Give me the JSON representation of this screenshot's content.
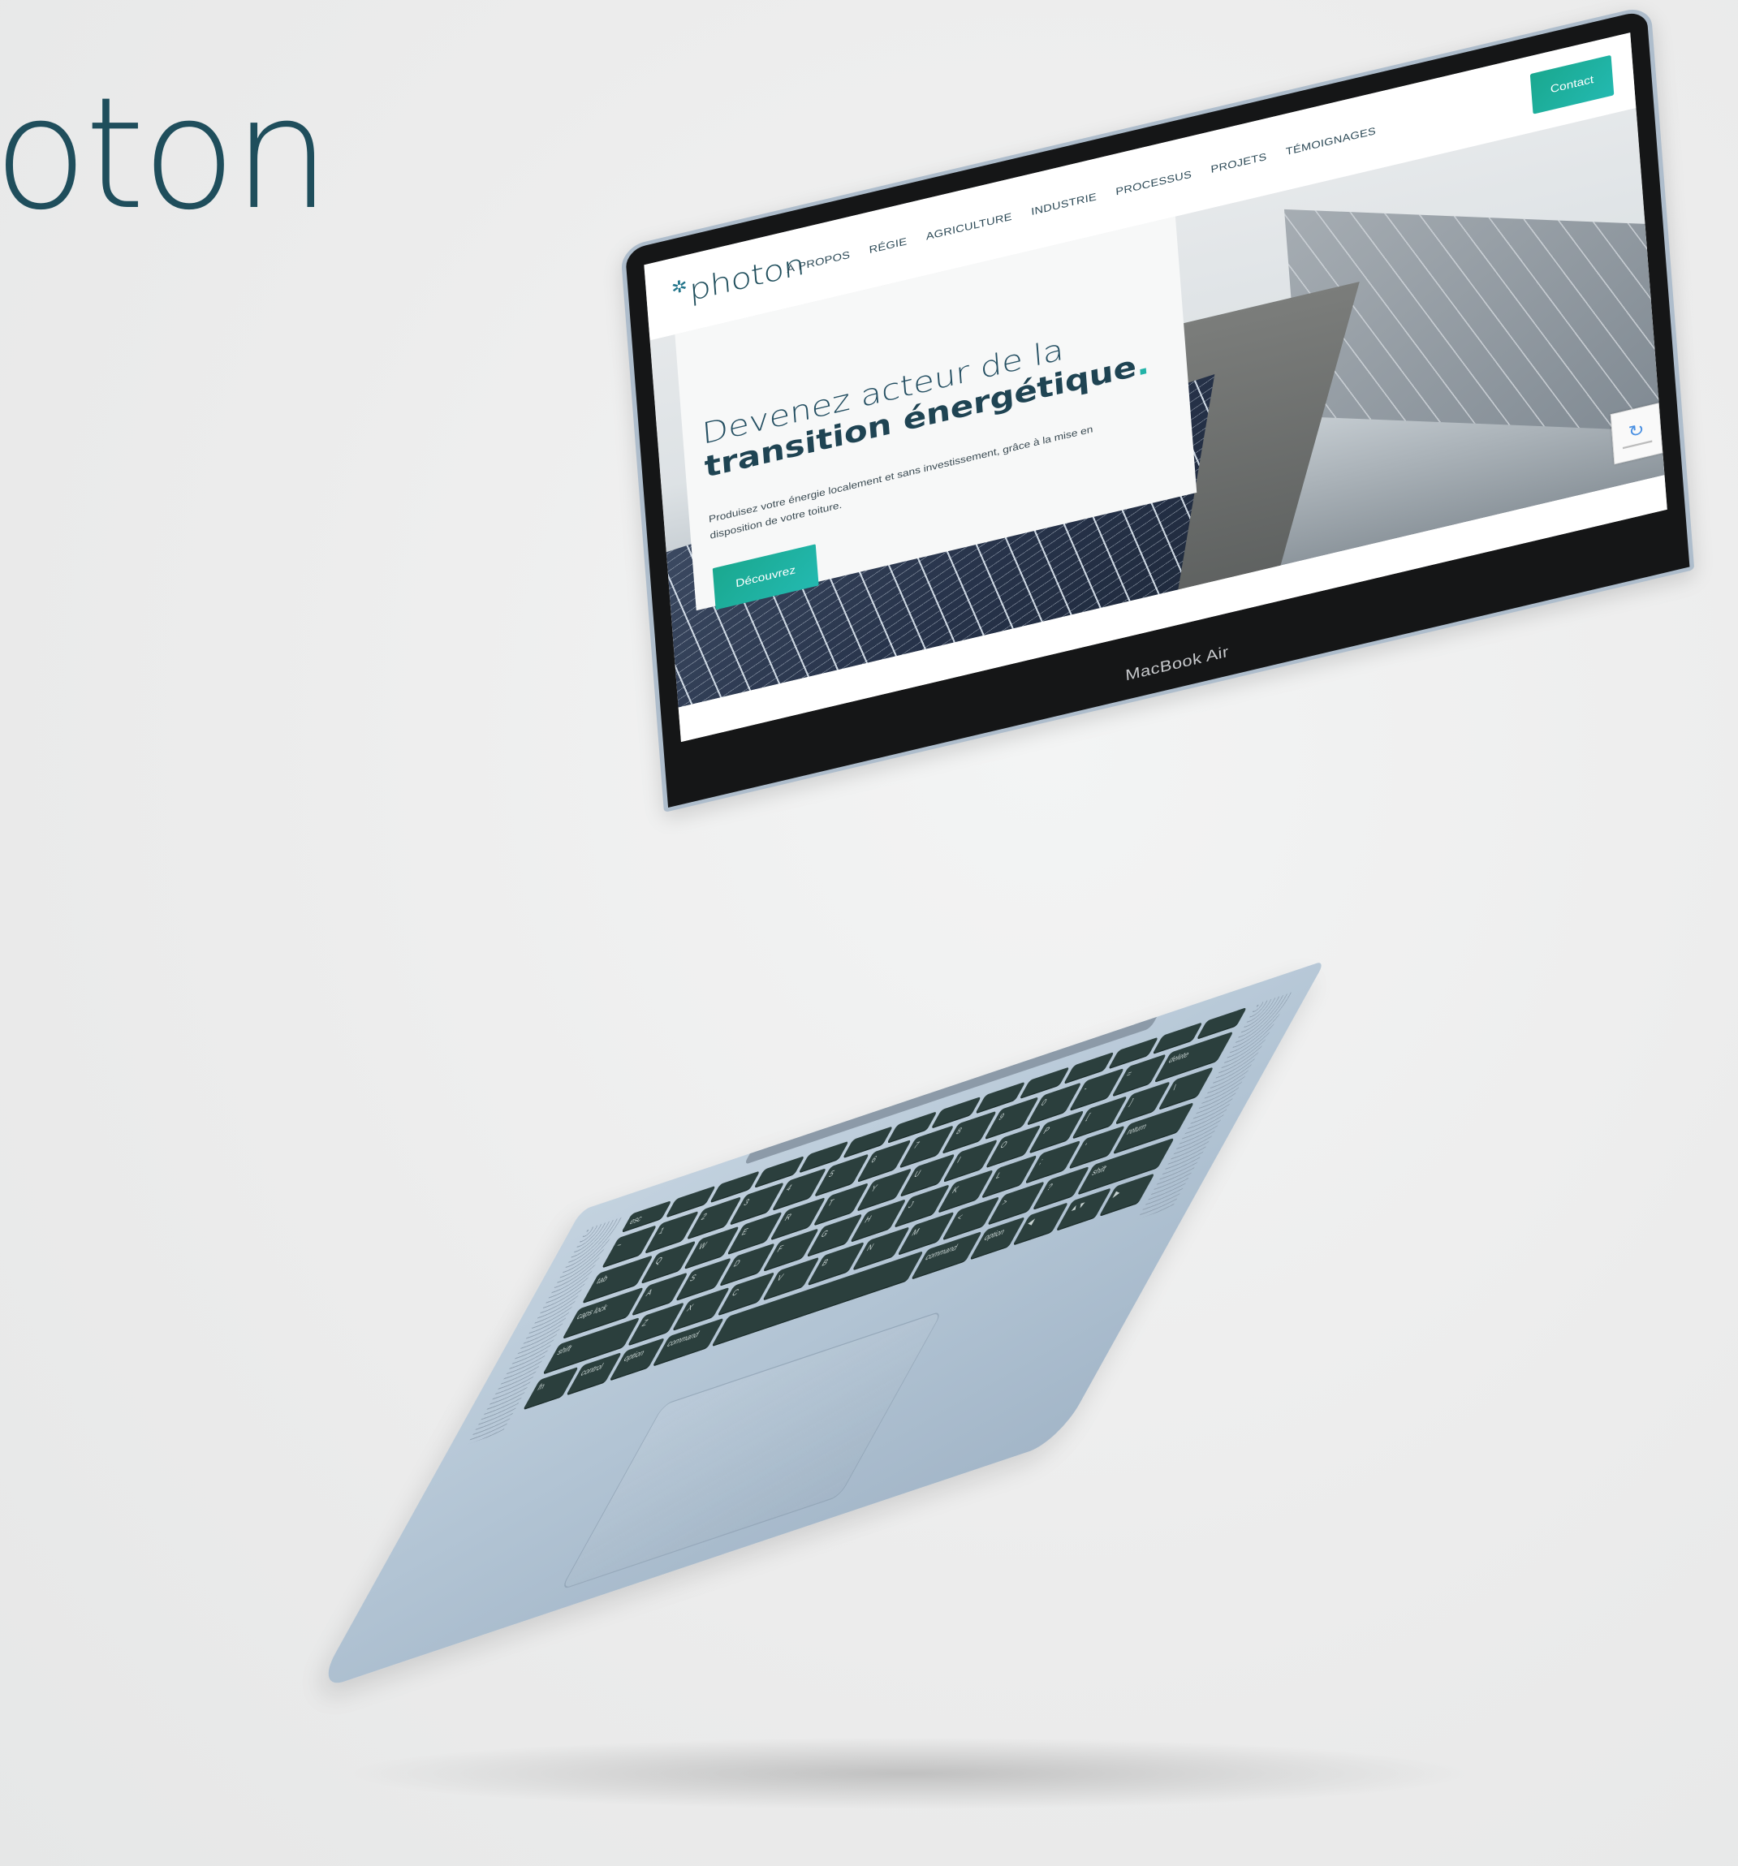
{
  "background_brand": {
    "text": "oton"
  },
  "website": {
    "logo": {
      "text": "photon",
      "icon": "sun-icon"
    },
    "nav": [
      "À PROPOS",
      "RÉGIE",
      "AGRICULTURE",
      "INDUSTRIE",
      "PROCESSUS",
      "PROJETS",
      "TÉMOIGNAGES"
    ],
    "contact_label": "Contact",
    "hero": {
      "title_line1": "Devenez acteur de la",
      "title_line2": "transition énergétique",
      "title_dot": ".",
      "description": "Produisez votre énergie localement et sans investissement, grâce à la mise en disposition de votre toiture.",
      "cta_label": "Découvrez"
    },
    "recaptcha_icon": "recaptcha-icon"
  },
  "device": {
    "label": "MacBook Air"
  },
  "keyboard": {
    "rows": [
      [
        "esc",
        "",
        "",
        "",
        "",
        "",
        "",
        "",
        "",
        "",
        "",
        "",
        "",
        ""
      ],
      [
        "~",
        "1",
        "2",
        "3",
        "4",
        "5",
        "6",
        "7",
        "8",
        "9",
        "0",
        "-",
        "=",
        "delete"
      ],
      [
        "tab",
        "Q",
        "W",
        "E",
        "R",
        "T",
        "Y",
        "U",
        "I",
        "O",
        "P",
        "[",
        "]",
        "\\"
      ],
      [
        "caps lock",
        "A",
        "S",
        "D",
        "F",
        "G",
        "H",
        "J",
        "K",
        "L",
        ";",
        "'",
        "return"
      ],
      [
        "shift",
        "Z",
        "X",
        "C",
        "V",
        "B",
        "N",
        "M",
        "<",
        ">",
        "?",
        "shift"
      ],
      [
        "fn",
        "control",
        "option",
        "command",
        "",
        "command",
        "option",
        "◀",
        "▲▼",
        "▶"
      ]
    ]
  },
  "colors": {
    "brand_dark": "#1f4e5c",
    "accent": "#1fb0a0",
    "aluminum": "#b2c4d4",
    "bezel": "#151617"
  }
}
